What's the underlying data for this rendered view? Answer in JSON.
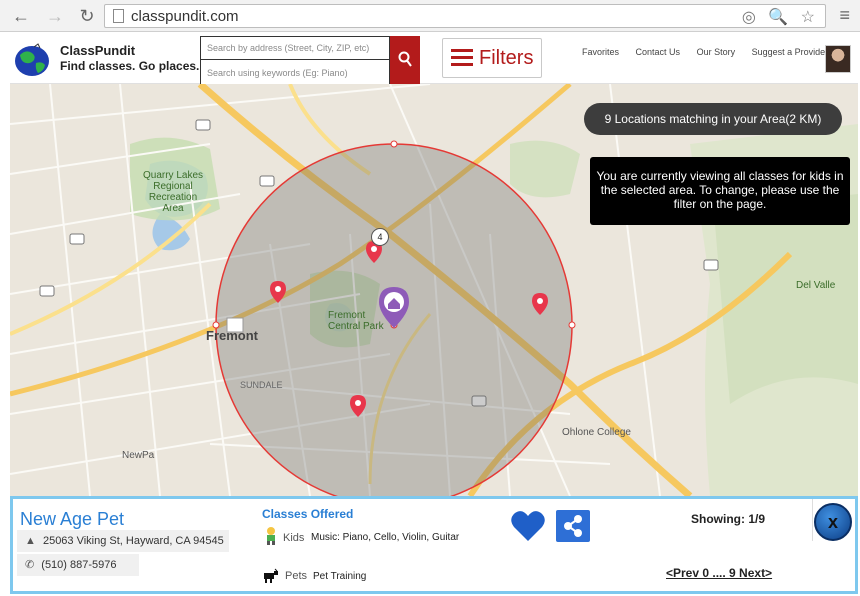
{
  "browser": {
    "url": "classpundit.com",
    "back_glyph": "←",
    "forward_glyph": "→",
    "reload_glyph": "↻",
    "menu_glyph": "≡",
    "omni_icons": "◎ 🔍 ☆"
  },
  "header": {
    "brand": "ClassPundit",
    "tagline": "Find classes. Go places.",
    "search_address_placeholder": "Search by address (Street, City, ZIP, etc)",
    "search_keywords_placeholder": "Search using keywords (Eg: Piano)",
    "filters_label": "Filters",
    "links": [
      "Favorites",
      "Contact Us",
      "Our Story",
      "Suggest a Provider"
    ]
  },
  "map": {
    "locations_pill": "9 Locations matching in your Area(2 KM)",
    "notice": "You are currently viewing all classes for kids in the selected area. To change, please use the filter on the page.",
    "cluster_count": "4",
    "labels": {
      "fremont": "Fremont",
      "quarry_lakes": "Quarry Lakes Regional Recreation Area",
      "central_park": "Fremont Central Park",
      "ohlone": "Ohlone College",
      "newark": "NewPa",
      "del_valle": "Del Valle",
      "sundale": "SUNDALE"
    }
  },
  "info": {
    "provider_name": "New Age Pet",
    "address": "25063 Viking St, Hayward, CA 94545",
    "phone": "(510) 887-5976",
    "classes_title": "Classes Offered",
    "categories": [
      {
        "name": "Kids",
        "classes": "Music: Piano, Cello, Violin, Guitar"
      },
      {
        "name": "Pets",
        "classes": "Pet Training"
      }
    ],
    "showing": "Showing: 1/9",
    "pager": "<Prev 0 .... 9 Next>",
    "close_label": "x",
    "colors": {
      "accent": "#2a7fd4",
      "brand_red": "#b31b1b",
      "panel_border": "#7ec8ee"
    }
  }
}
